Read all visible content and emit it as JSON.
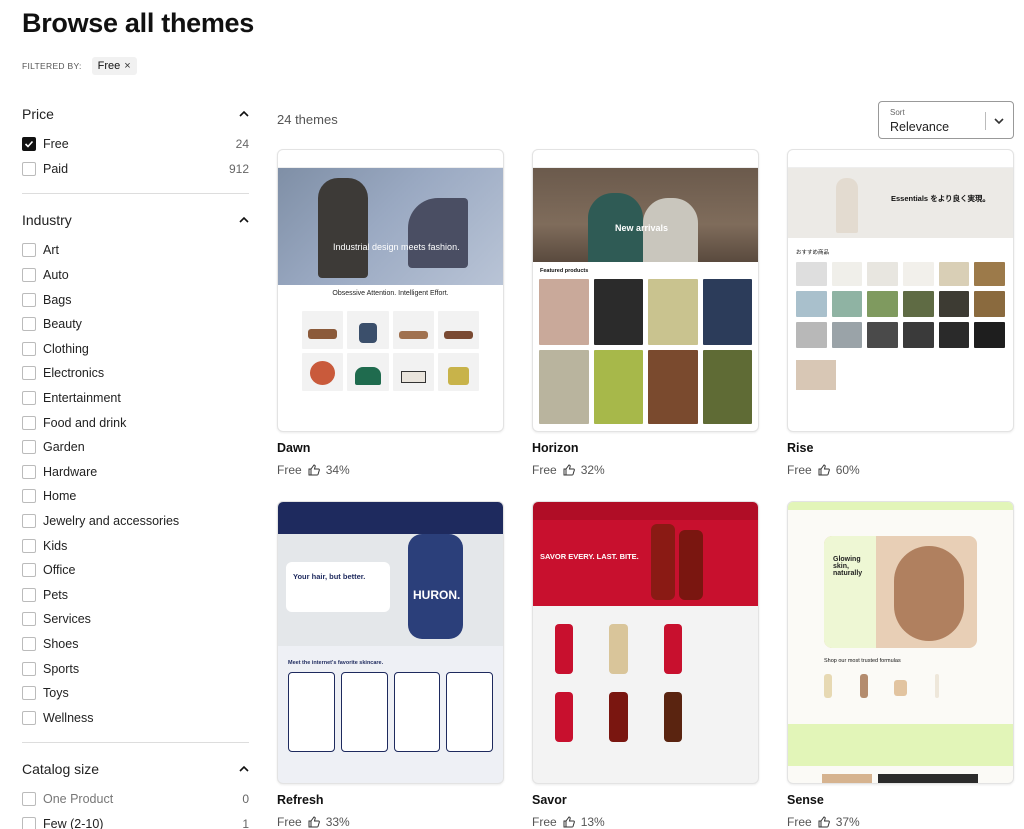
{
  "page": {
    "title": "Browse all themes"
  },
  "filters": {
    "label": "FILTERED BY:",
    "active": "Free",
    "remove_glyph": "×"
  },
  "sidebar": {
    "price": {
      "title": "Price",
      "options": [
        {
          "label": "Free",
          "count": "24",
          "checked": true
        },
        {
          "label": "Paid",
          "count": "912",
          "checked": false
        }
      ]
    },
    "industry": {
      "title": "Industry",
      "options": [
        "Art",
        "Auto",
        "Bags",
        "Beauty",
        "Clothing",
        "Electronics",
        "Entertainment",
        "Food and drink",
        "Garden",
        "Hardware",
        "Home",
        "Jewelry and accessories",
        "Kids",
        "Office",
        "Pets",
        "Services",
        "Shoes",
        "Sports",
        "Toys",
        "Wellness"
      ]
    },
    "catalog": {
      "title": "Catalog size",
      "options": [
        {
          "label": "One Product",
          "count": "0"
        },
        {
          "label": "Few (2-10)",
          "count": "1"
        }
      ]
    }
  },
  "results": {
    "count_label": "24 themes"
  },
  "sort": {
    "label": "Sort",
    "value": "Relevance"
  },
  "themes": [
    {
      "name": "Dawn",
      "price": "Free",
      "rating": "34%",
      "hero_text": "Industrial design meets fashion.",
      "sub_text": "Obsessive Attention. Intelligent Effort."
    },
    {
      "name": "Horizon",
      "price": "Free",
      "rating": "32%",
      "hero_text": "New arrivals",
      "sub_text": "Featured products"
    },
    {
      "name": "Rise",
      "price": "Free",
      "rating": "60%",
      "hero_text": "Essentials をより良く実現。",
      "sub_text": "おすすめ商品"
    },
    {
      "name": "Refresh",
      "price": "Free",
      "rating": "33%",
      "hero_text": "Your hair, but better.",
      "sub_text": "Meet the internet's favorite skincare.",
      "brand": "HURON."
    },
    {
      "name": "Savor",
      "price": "Free",
      "rating": "13%",
      "hero_text": "SAVOR EVERY. LAST. BITE."
    },
    {
      "name": "Sense",
      "price": "Free",
      "rating": "37%",
      "hero_text": "Glowing skin, naturally",
      "sub_text": "Shop our most trusted formulas"
    }
  ],
  "colors": {
    "accent": "#111111",
    "refresh_bg": "#1e2a5e",
    "savor_red": "#c8102e",
    "sense_green": "#e2f5b8"
  }
}
